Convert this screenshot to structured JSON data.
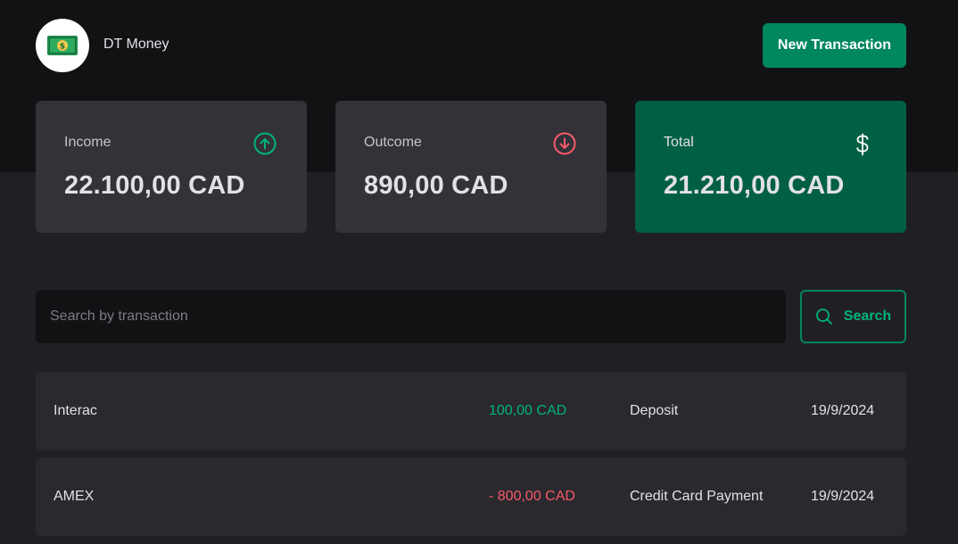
{
  "header": {
    "app_title": "DT Money",
    "logo_icon": "money-bill-icon",
    "new_transaction_label": "New Transaction"
  },
  "summary": {
    "income": {
      "label": "Income",
      "value": "22.100,00 CAD",
      "icon": "arrow-circle-up-icon",
      "color": "#00b37e"
    },
    "outcome": {
      "label": "Outcome",
      "value": "890,00 CAD",
      "icon": "arrow-circle-down-icon",
      "color": "#f75a68"
    },
    "total": {
      "label": "Total",
      "value": "21.210,00 CAD",
      "icon": "currency-dollar-icon",
      "color": "#ffffff"
    }
  },
  "search": {
    "placeholder": "Search by transaction",
    "value": "",
    "button_label": "Search"
  },
  "transactions": [
    {
      "description": "Interac",
      "amount": "100,00 CAD",
      "type": "income",
      "category": "Deposit",
      "date": "19/9/2024"
    },
    {
      "description": "AMEX",
      "amount": "- 800,00 CAD",
      "type": "outcome",
      "category": "Credit Card Payment",
      "date": "19/9/2024"
    }
  ],
  "colors": {
    "brand": "#00875f",
    "brand_light": "#00b37e",
    "danger": "#f75a68",
    "background": "#202024",
    "header_background": "#121214"
  }
}
